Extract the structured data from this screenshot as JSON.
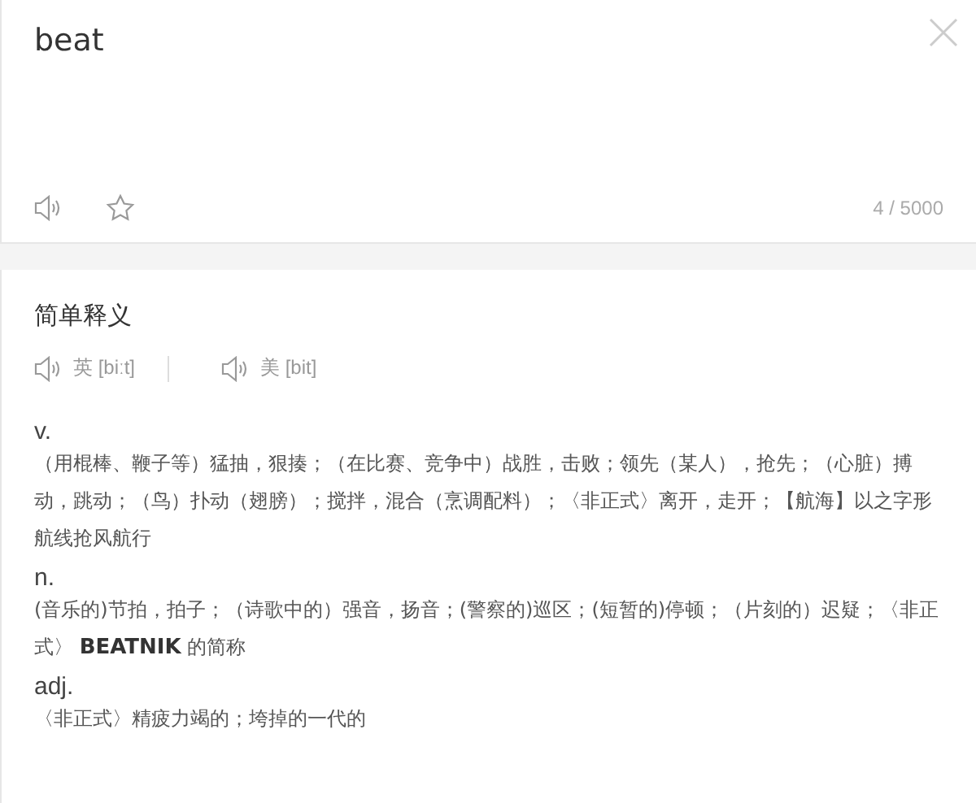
{
  "input": {
    "value": "beat",
    "counter": "4 / 5000"
  },
  "section_title": "简单释义",
  "pronunciations": [
    {
      "label": "英 [biːt]"
    },
    {
      "label": "美 [bit]"
    }
  ],
  "definitions": [
    {
      "pos": "v.",
      "text": "（用棍棒、鞭子等）猛抽，狠揍；（在比赛、竞争中）战胜，击败；领先（某人），抢先；（心脏）搏动，跳动；（鸟）扑动（翅膀）；搅拌，混合（烹调配料）；〈非正式〉离开，走开；【航海】以之字形航线抢风航行"
    },
    {
      "pos": "n.",
      "text": "(音乐的)节拍，拍子；（诗歌中的）强音，扬音；(警察的)巡区；(短暂的)停顿；（片刻的）迟疑；〈非正式〉 **BEATNIK** 的简称"
    },
    {
      "pos": "adj.",
      "text": "〈非正式〉精疲力竭的；垮掉的一代的"
    }
  ]
}
